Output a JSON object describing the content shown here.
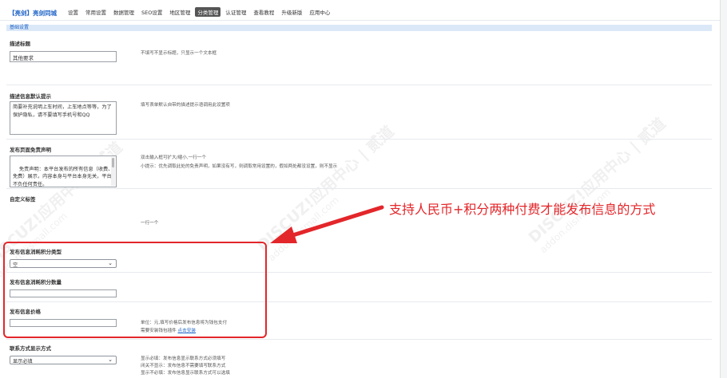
{
  "topnav": {
    "brand": "【亮剑】亮剑同城",
    "items": [
      "设置",
      "常用设置",
      "数据管理",
      "SEO设置",
      "地区管理",
      "分类管理",
      "认证管理",
      "查看教程",
      "升级新版",
      "应用中心"
    ],
    "active_index": 5
  },
  "subbar": {
    "label": "基础设置"
  },
  "sections": {
    "desc_title": {
      "title": "描述标题",
      "value": "其他要求",
      "hint": "不填写不显示标题，只显示一个文本框"
    },
    "desc_default": {
      "title": "描述信息默认提示",
      "value": "简要补充说明上车时间，上车地点等等，为了保护隐私，请不要填写手机号和QQ",
      "hint": "填写表单默认自带的描述提示语调用此设置项"
    },
    "disclaimer": {
      "title": "发布页面免责声明",
      "value": "免责声明：本平台发布的所有信息（收费、免费）展示，内容本身与平台本身无关，平台不负任何责任。\n禁止骚扰，刷单在此栏目发布，否则一率删除。",
      "hint1": "双击输入框可扩大/缩小,一行一个",
      "hint2": "小提示：优先调取此处的免责声明，如果没有写，则调取常用设置的，假如两处都没设置，则不显示"
    },
    "custom_tags": {
      "title": "自定义标签",
      "hint": "一行一个"
    },
    "points_type": {
      "title": "发布信息消耗积分类型",
      "selected": "空"
    },
    "points_amount": {
      "title": "发布信息消耗积分数量"
    },
    "price": {
      "title": "发布信息价格",
      "hint1": "单位：元,填写价格后发布信息将为钱包支付",
      "hint2": "需要安装钱包插件",
      "link": "点击安装"
    },
    "contact": {
      "title": "联系方式显示方式",
      "selected": "显示必填",
      "hint1": "显示必填：发布信息显示联系方式必须填写",
      "hint2": "闭关不显示：发布信息不需要填写联系方式",
      "hint3": "显示不必填：发布信息显示联系方式可以选填"
    }
  },
  "annotation": {
    "text": "支持人民币+积分两种付费才能发布信息的方式",
    "color": "#e3262a"
  },
  "watermark": {
    "line1": "DISCUZ!应用中心 | 贰道",
    "line2": "addon.dismall.com"
  },
  "colors": {
    "brand": "#1c62c6",
    "active_tab_bg": "#555555",
    "annotation": "#e3262a"
  }
}
